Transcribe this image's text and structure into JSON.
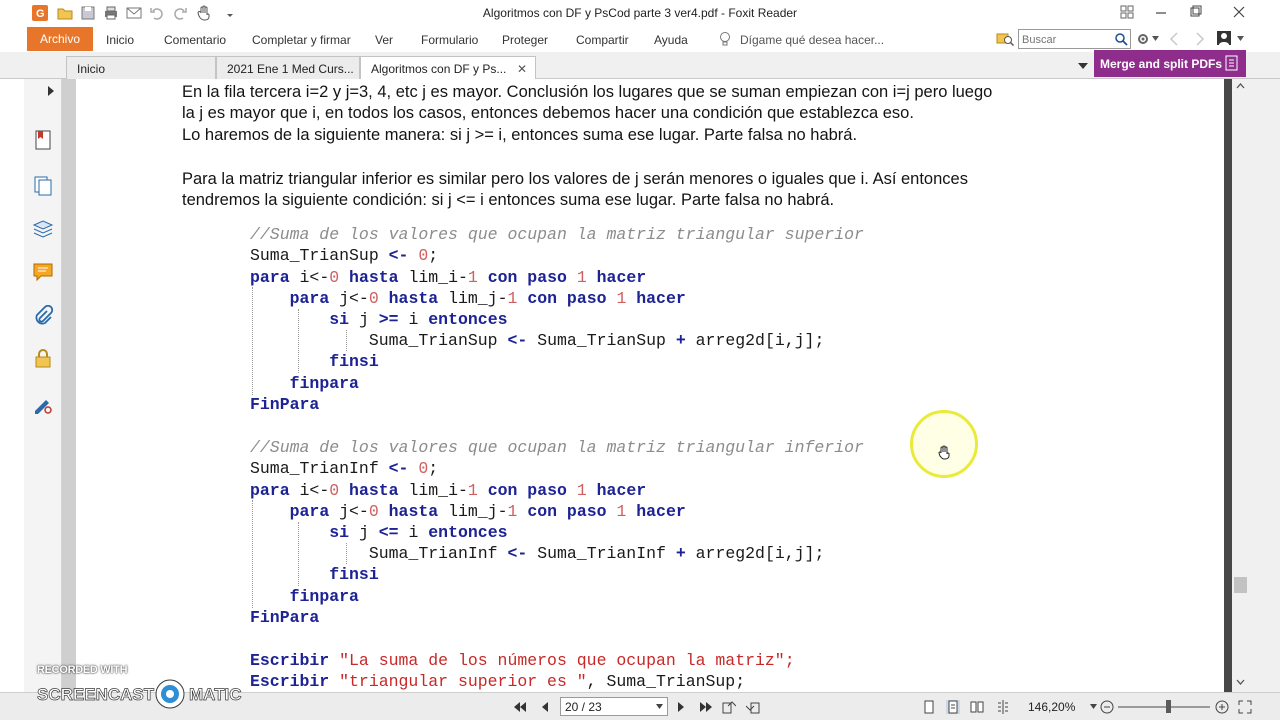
{
  "window": {
    "title": "Algoritmos con DF y PsCod parte 3 ver4.pdf - Foxit Reader"
  },
  "ribbon": {
    "file_label": "Archivo",
    "tabs": [
      "Inicio",
      "Comentario",
      "Completar y firmar",
      "Ver",
      "Formulario",
      "Proteger",
      "Compartir",
      "Ayuda"
    ],
    "tell_me": "Dígame qué desea hacer...",
    "search_placeholder": "Buscar"
  },
  "doc_tabs": [
    {
      "label": "Inicio",
      "active": false
    },
    {
      "label": "2021 Ene 1 Med Curs...",
      "active": false
    },
    {
      "label": "Algoritmos con DF y Ps...",
      "active": true
    }
  ],
  "merge_button": "Merge and split PDFs",
  "document": {
    "paragraphs": [
      "En la fila tercera i=2 y j=3, 4, etc j es mayor. Conclusión los lugares que se suman empiezan con i=j pero luego",
      "la j es mayor que i, en todos los casos, entonces debemos hacer una condición que establezca eso.",
      "Lo haremos de la siguiente manera: si j >= i, entonces suma ese lugar. Parte falsa no habrá.",
      "Para la matriz triangular inferior es similar pero los valores de j serán menores o iguales que i. Así entonces",
      "tendremos la siguiente condición: si j <= i entonces suma ese lugar. Parte falsa no habrá."
    ],
    "code_sup": {
      "comment": "//Suma de los valores que ocupan la matriz triangular superior",
      "var": "Suma_TrianSup",
      "condition_op": ">=",
      "body_expr": "arreg2d[i,j];"
    },
    "code_inf": {
      "comment": "//Suma de los valores que ocupan la matriz triangular inferior",
      "var": "Suma_TrianInf",
      "condition_op": "<=",
      "body_expr": "arreg2d[i,j];"
    },
    "code_kw": {
      "para": "para",
      "hasta": "hasta",
      "con_paso": "con paso",
      "hacer": "hacer",
      "si": "si",
      "entonces": "entonces",
      "finsi": "finsi",
      "finpara": "finpara",
      "FinPara": "FinPara",
      "Escribir": "Escribir",
      "assign": "<-",
      "zero": "0",
      "one": "1",
      "semicolon": ";",
      "lim_i": "lim_i-",
      "lim_j": "lim_j-",
      "i_from": "i<-",
      "j_from": "j<-",
      "var_i": "i",
      "var_j": "j",
      "plus": "+"
    },
    "escribir_1": "\"La suma de los números que ocupan la matriz\";",
    "escribir_2_str": "\"triangular superior es \"",
    "escribir_2_rest": ", Suma_TrianSup;"
  },
  "status": {
    "page_field": "20 / 23",
    "zoom": "146,20%"
  },
  "watermark": {
    "recorded_with": "RECORDED WITH",
    "brand_left": "SCREENCAST",
    "brand_right": "MATIC"
  },
  "colors": {
    "file_tab": "#e8762a",
    "merge": "#8e2d8c",
    "keyword": "#1d2394",
    "comment": "#8c8c8c",
    "number": "#d06060",
    "string": "#c82828",
    "cursor_ring": "#eaea3a"
  }
}
